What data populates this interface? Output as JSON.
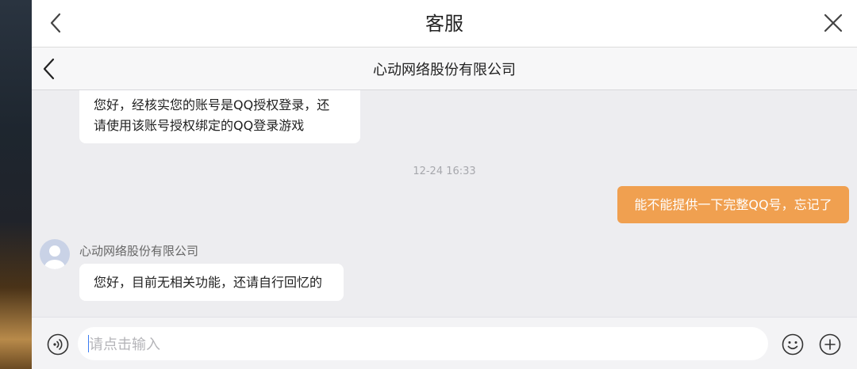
{
  "header": {
    "title": "客服"
  },
  "subheader": {
    "title": "心动网络股份有限公司"
  },
  "chat": {
    "messages": [
      {
        "from": "agent",
        "text_line1": "您好，经核实您的账号是QQ授权登录，还",
        "text_line2": "请使用该账号授权绑定的QQ登录游戏"
      },
      {
        "type": "timestamp",
        "text": "12-24 16:33"
      },
      {
        "from": "user",
        "text": "能不能提供一下完整QQ号，忘记了"
      },
      {
        "from": "agent",
        "sender": "心动网络股份有限公司",
        "text": "您好，目前无相关功能，还请自行回忆的"
      }
    ]
  },
  "input": {
    "placeholder": "请点击输入"
  },
  "colors": {
    "user_bubble": "#f0a050",
    "chat_bg": "#ededf0",
    "avatar": "#c9d2e6"
  },
  "icons": [
    "back-icon",
    "close-icon",
    "voice-icon",
    "emoji-icon",
    "plus-icon"
  ]
}
